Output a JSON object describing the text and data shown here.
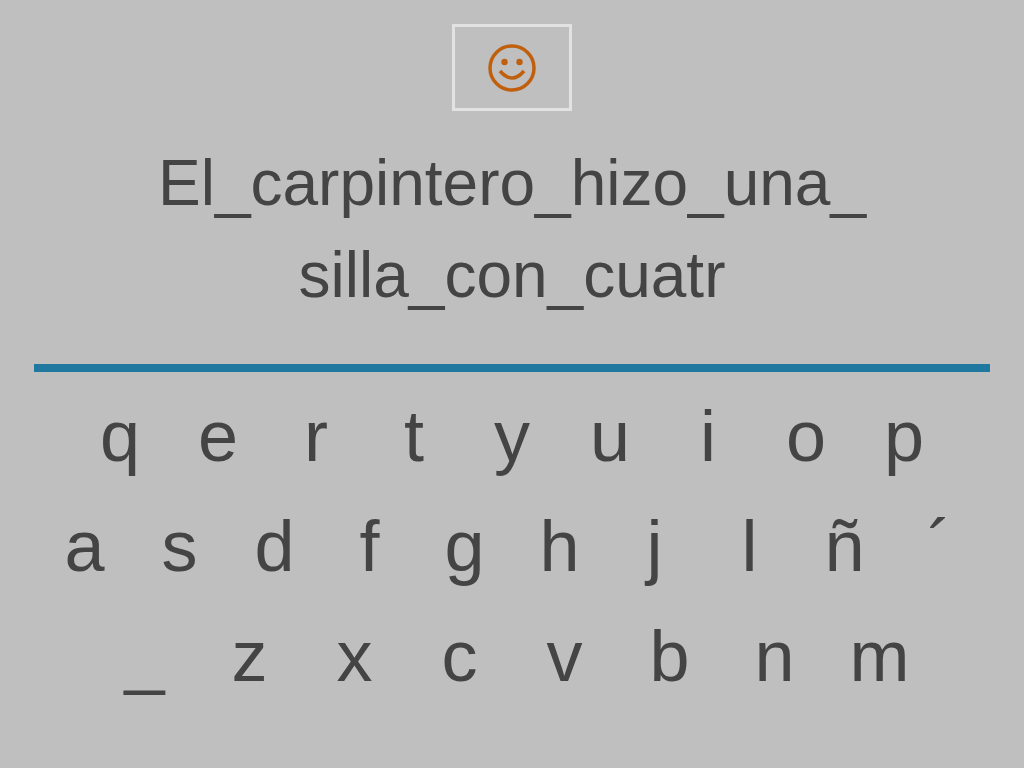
{
  "sentence_lines": [
    "El_carpintero_hizo_una_",
    "silla_con_cuatr"
  ],
  "keyboard_rows": [
    [
      "q",
      "e",
      "r",
      "t",
      "y",
      "u",
      "i",
      "o",
      "p"
    ],
    [
      "a",
      "s",
      "d",
      "f",
      "g",
      "h",
      "j",
      "l",
      "ñ",
      "´"
    ],
    [
      "_",
      "z",
      "x",
      "c",
      "v",
      "b",
      "n",
      "m"
    ]
  ]
}
